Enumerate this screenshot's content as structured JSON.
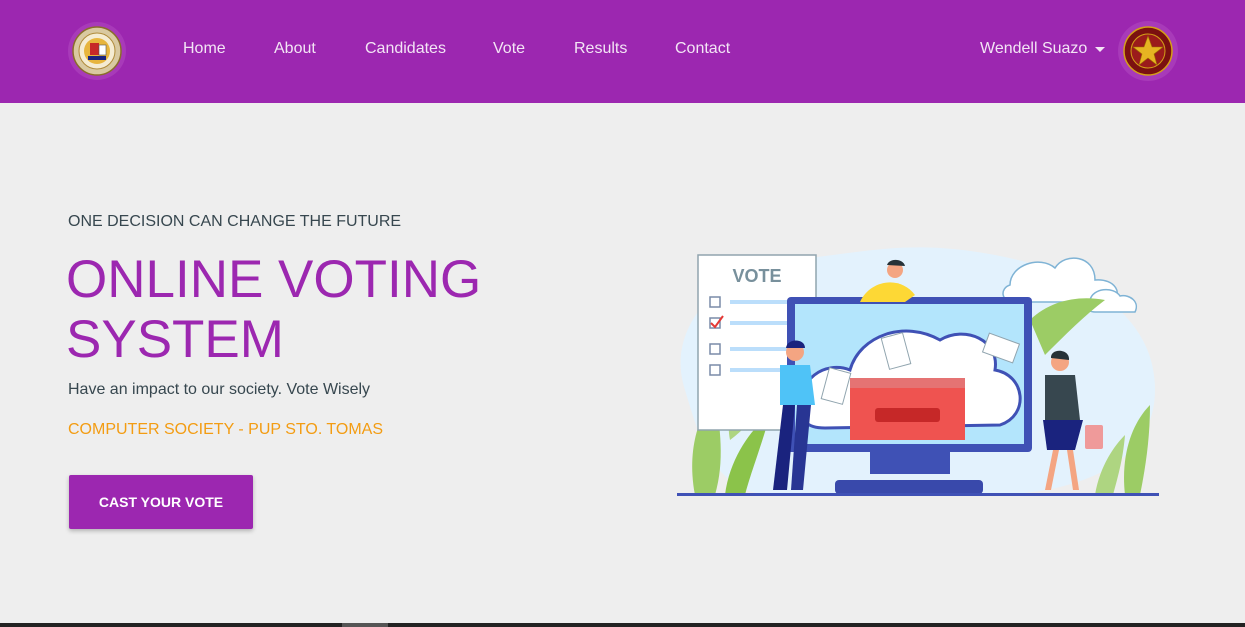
{
  "nav": {
    "items": [
      {
        "label": "Home"
      },
      {
        "label": "About"
      },
      {
        "label": "Candidates"
      },
      {
        "label": "Vote"
      },
      {
        "label": "Results"
      },
      {
        "label": "Contact"
      }
    ],
    "user_name": "Wendell Suazo"
  },
  "hero": {
    "eyebrow": "ONE DECISION CAN CHANGE THE FUTURE",
    "title_line1": "ONLINE VOTING",
    "title_line2": "SYSTEM",
    "tagline": "Have an impact to our society. Vote Wisely",
    "organization": "COMPUTER SOCIETY - PUP STO. TOMAS",
    "cta_label": "CAST YOUR VOTE",
    "illustration_word": "VOTE"
  },
  "colors": {
    "primary": "#9c27b0",
    "accent": "#f39c12",
    "background": "#eeeeee",
    "text": "#37474f"
  },
  "icons": {
    "left_logo": "school-seal-icon",
    "right_logo": "university-seal-icon",
    "dropdown": "caret-down-icon"
  }
}
